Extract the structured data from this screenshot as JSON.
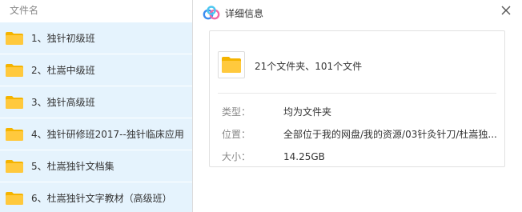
{
  "list": {
    "header": "文件名",
    "items": [
      {
        "label": "1、独针初级班"
      },
      {
        "label": "2、杜嵩中级班"
      },
      {
        "label": "3、独针高级班"
      },
      {
        "label": "4、独针研修班2017--独针临床应用"
      },
      {
        "label": "5、杜嵩独针文档集"
      },
      {
        "label": "6、杜嵩独针文字教材（高级班）"
      }
    ]
  },
  "panel": {
    "title": "详细信息",
    "summary": "21个文件夹、101个文件",
    "properties": [
      {
        "key": "类型：",
        "value": "均为文件夹"
      },
      {
        "key": "位置：",
        "value": "全部位于我的网盘/我的资源/03针灸针刀/杜嵩独..."
      },
      {
        "key": "大小：",
        "value": "14.25GB"
      }
    ]
  },
  "colors": {
    "row_selected_bg": "#e5f3fd",
    "folder_yellow": "#ffc93d",
    "folder_tab": "#f5b400",
    "logo_blue": "#3b8cf0",
    "logo_pink": "#f06aa5",
    "logo_cyan": "#4cc7f0"
  },
  "icons": {
    "folder": "folder-icon",
    "logo": "baidu-netdisk-logo-icon",
    "close": "close-icon"
  }
}
